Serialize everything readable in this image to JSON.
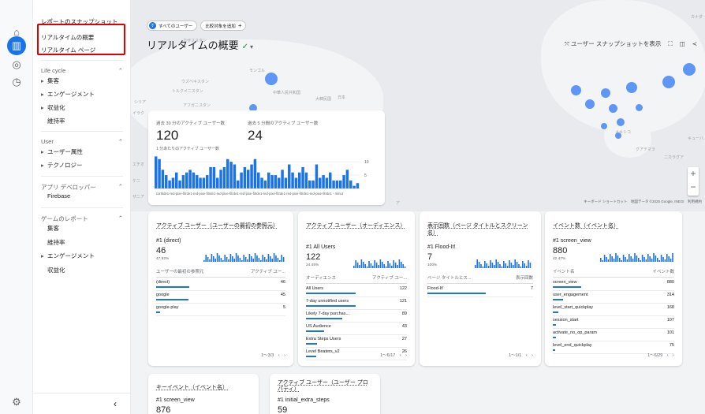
{
  "sidebar": {
    "top_items": [
      "レポートのスナップショット",
      "リアルタイムの概要",
      "リアルタイム ページ"
    ],
    "sections": [
      {
        "title": "Life cycle",
        "items": [
          {
            "label": "集客",
            "expandable": true
          },
          {
            "label": "エンゲージメント",
            "expandable": true
          },
          {
            "label": "収益化",
            "expandable": true
          },
          {
            "label": "維持率",
            "expandable": false
          }
        ]
      },
      {
        "title": "User",
        "items": [
          {
            "label": "ユーザー属性",
            "expandable": true
          },
          {
            "label": "テクノロジー",
            "expandable": true
          }
        ]
      },
      {
        "title": "アプリ デベロッパー",
        "items": [
          {
            "label": "Firebase",
            "expandable": false
          }
        ]
      },
      {
        "title": "ゲームのレポート",
        "items": [
          {
            "label": "集客",
            "expandable": false
          },
          {
            "label": "維持率",
            "expandable": false
          },
          {
            "label": "エンゲージメント",
            "expandable": true
          },
          {
            "label": "収益化",
            "expandable": false
          }
        ]
      }
    ],
    "collapse_icon": "‹"
  },
  "header": {
    "chip_all": "すべてのユーザー",
    "chip_all_icon": "す",
    "chip_add": "比較対象を追加",
    "chip_add_icon": "+",
    "title": "リアルタイムの概要",
    "status_icon": "✓",
    "snapshot_label": "ユーザー スナップショットを表示"
  },
  "map": {
    "labels": [
      "カナダ",
      "カザフスタン",
      "モンゴル",
      "ウズベキスタン",
      "トルクメニスタン",
      "中華人民共和国",
      "大韓民国",
      "日本",
      "アフガニスタン",
      "シリア",
      "イラク",
      "エチオ",
      "ケニ",
      "ザニア",
      "メキシコ",
      "グアテマラ",
      "ニカラグア",
      "キューバ",
      "エク",
      "ア"
    ],
    "footer": "キーボード ショートカット　地図データ ©2025 Google, INEGI　利用規約"
  },
  "realtime": {
    "metric1_label": "過去 30 分のアクティブ ユーザー数",
    "metric1_value": "120",
    "metric2_label": "過去 5 分間のアクティブ ユーザー数",
    "metric2_value": "24",
    "sub_label": "1 分あたりのアクティブ ユーザー数",
    "x_tick_text": "cortitde1-red-pixe-fitrde1-red-pixe-fitrde1-red-pixe-fitrde1-red-pixe-fitrde1-red-pixe-fitrde1-red-pixe-fitrde1-red-pixe-fitrde1 - minut",
    "y_ticks": [
      "10",
      "5"
    ],
    "color": "#1a73e8"
  },
  "chart_data": {
    "type": "bar",
    "title": "1 分あたりのアクティブ ユーザー数",
    "ylim": [
      0,
      13
    ],
    "y_ticks": [
      5,
      10
    ],
    "values": [
      12,
      11,
      7,
      5,
      3,
      4,
      6,
      3,
      5,
      6,
      7,
      6,
      5,
      4,
      4,
      5,
      8,
      8,
      4,
      7,
      8,
      11,
      10,
      9,
      3,
      6,
      8,
      7,
      9,
      11,
      6,
      4,
      3,
      6,
      5,
      5,
      4,
      7,
      4,
      9,
      6,
      4,
      6,
      8,
      6,
      3,
      3,
      9,
      4,
      5,
      4,
      6,
      3,
      3,
      3,
      5,
      7,
      3,
      1,
      2
    ]
  },
  "cards": [
    {
      "title": "アクティブ ユーザー（ユーザーの最初の参照元）",
      "rank": "#1 (direct)",
      "big": "46",
      "pct": "47.92%",
      "col1": "ユーザーの最初の参照元",
      "col2": "アクティブ ユー...",
      "rows": [
        {
          "label": "(direct)",
          "value": "46",
          "frac": 0.47
        },
        {
          "label": "google",
          "value": "45",
          "frac": 0.46
        },
        {
          "label": "google-play",
          "value": "5",
          "frac": 0.05
        }
      ],
      "pager": "1～3/3　‹　›"
    },
    {
      "title": "アクティブ ユーザー（オーディエンス）",
      "rank": "#1 All Users",
      "big": "122",
      "pct": "24.45%",
      "col1": "オーディエンス",
      "col2": "アクティブ ユー...",
      "rows": [
        {
          "label": "All Users",
          "value": "122",
          "frac": 0.9
        },
        {
          "label": "7-day unnotified users",
          "value": "121",
          "frac": 0.89
        },
        {
          "label": "Likely 7-day purchas...",
          "value": "89",
          "frac": 0.66
        },
        {
          "label": "US Audience",
          "value": "43",
          "frac": 0.32
        },
        {
          "label": "Extra Steps Users",
          "value": "27",
          "frac": 0.2
        },
        {
          "label": "Level Beaters_v2",
          "value": "26",
          "frac": 0.19
        }
      ],
      "pager": "1～6/17　‹　›"
    },
    {
      "title": "表示回数（ページ タイトルとスクリーン名）",
      "rank": "#1 Flood-It!",
      "big": "7",
      "pct": "100%",
      "col1": "ページ タイトルとス...",
      "col2": "表示回数",
      "rows": [
        {
          "label": "Flood-It!",
          "value": "7",
          "frac": 1.0
        }
      ],
      "pager": "1～1/1　‹　›"
    },
    {
      "title": "イベント数（イベント名）",
      "rank": "#1 screen_view",
      "big": "880",
      "pct": "42.47%",
      "col1": "イベント名",
      "col2": "イベント数",
      "rows": [
        {
          "label": "screen_view",
          "value": "880",
          "frac": 0.42
        },
        {
          "label": "user_engagement",
          "value": "314",
          "frac": 0.15
        },
        {
          "label": "level_start_quickplay",
          "value": "168",
          "frac": 0.08
        },
        {
          "label": "session_start",
          "value": "107",
          "frac": 0.05
        },
        {
          "label": "activate_no_op_param",
          "value": "101",
          "frac": 0.05
        },
        {
          "label": "level_end_quickplay",
          "value": "75",
          "frac": 0.04
        }
      ],
      "pager": "1～6/29　‹　›"
    }
  ],
  "bottom_cards": [
    {
      "title": "キーイベント（イベント名）",
      "rank": "#1 screen_view",
      "big": "876"
    },
    {
      "title": "アクティブ ユーザー（ユーザー プロパティ）",
      "rank": "#1 initial_extra_steps",
      "big": "59"
    }
  ]
}
